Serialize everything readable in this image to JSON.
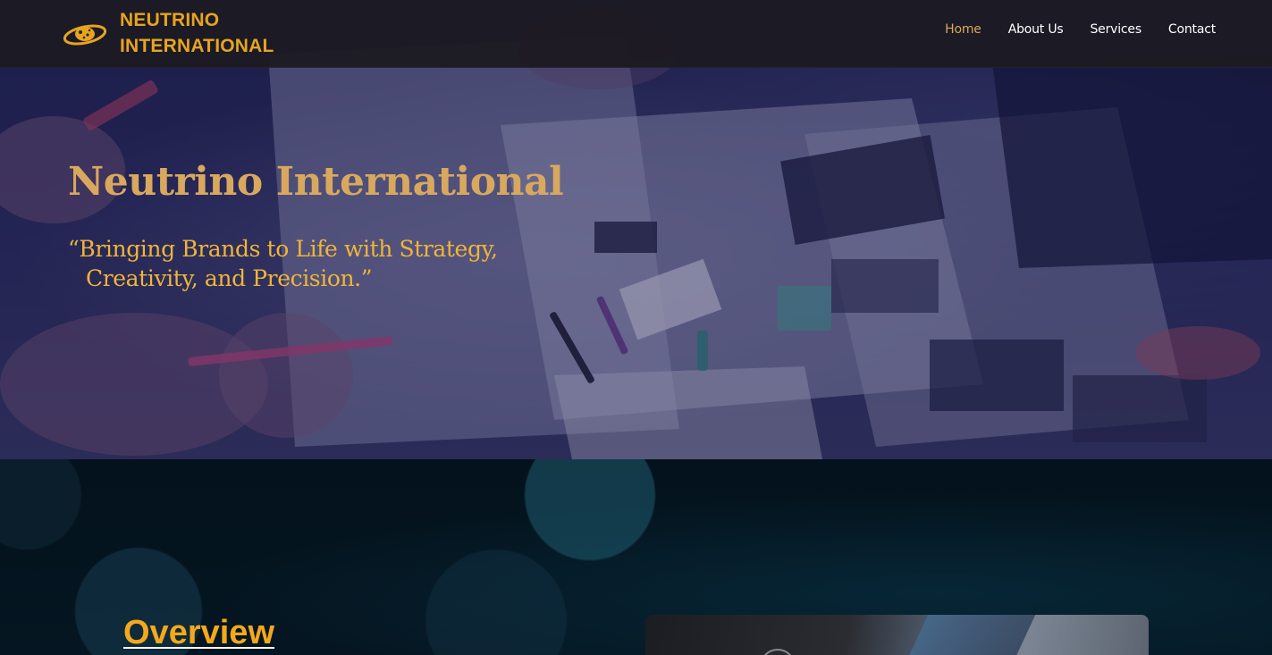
{
  "brand": {
    "line1": "NEUTRINO",
    "line2": "INTERNATIONAL",
    "logo_icon": "orbit-logo-icon",
    "color": "#e6a421"
  },
  "nav": {
    "items": [
      {
        "label": "Home",
        "active": true
      },
      {
        "label": "About Us",
        "active": false
      },
      {
        "label": "Services",
        "active": false
      },
      {
        "label": "Contact",
        "active": false
      }
    ],
    "active_color": "#d9a85f"
  },
  "hero": {
    "title": "Neutrino International",
    "quote_line1": "“Bringing Brands to Life with Strategy,",
    "quote_line2": "Creativity, and Precision.”"
  },
  "overview": {
    "heading": "Overview"
  },
  "colors": {
    "accent_gold": "#d9a85f",
    "quote_gold": "#f0b43a",
    "overview_orange": "#f4a81c",
    "section_bg": "#03121c"
  }
}
